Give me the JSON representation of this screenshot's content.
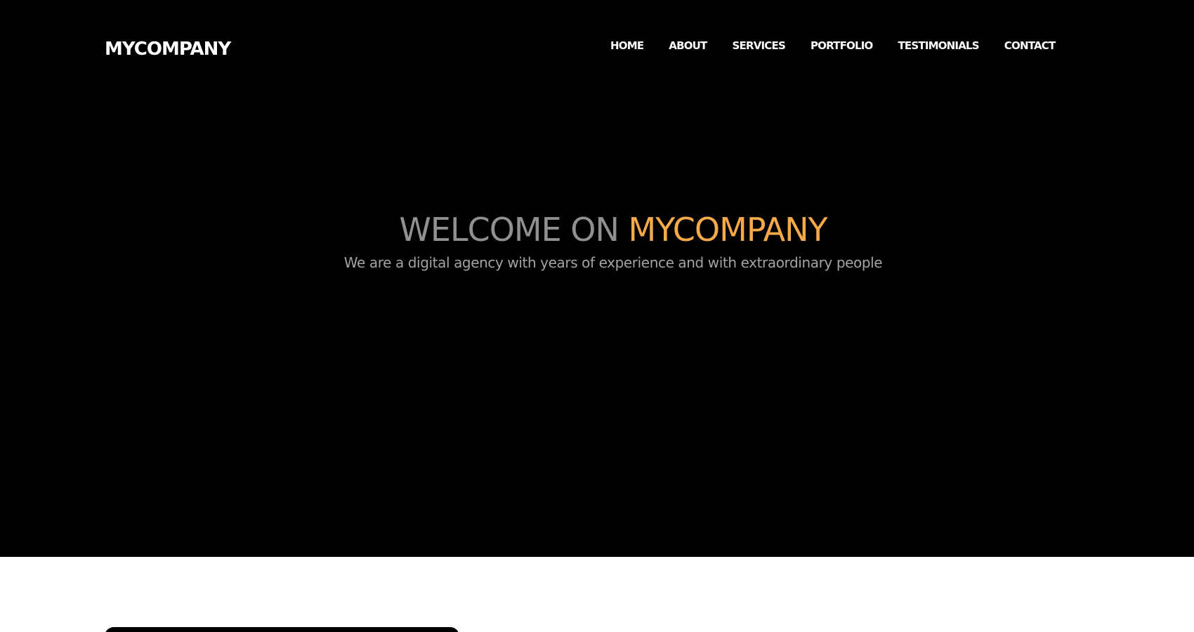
{
  "brand": {
    "name": "MYCOMPANY"
  },
  "navigation": {
    "items": [
      {
        "label": "HOME"
      },
      {
        "label": "ABOUT"
      },
      {
        "label": "SERVICES"
      },
      {
        "label": "PORTFOLIO"
      },
      {
        "label": "TESTIMONIALS"
      },
      {
        "label": "CONTACT"
      }
    ]
  },
  "hero": {
    "title_prefix": "WELCOME ON",
    "title_highlight": "MYCOMPANY",
    "subtitle": "We are a digital agency with years of experience and with extraordinary people"
  },
  "colors": {
    "hero_background": "#000000",
    "navigation_text": "#ffffff",
    "title_gray": "#909090",
    "title_accent": "#f7aa4a",
    "subtitle_gray": "#a3a3a3",
    "page_background": "#ffffff"
  }
}
